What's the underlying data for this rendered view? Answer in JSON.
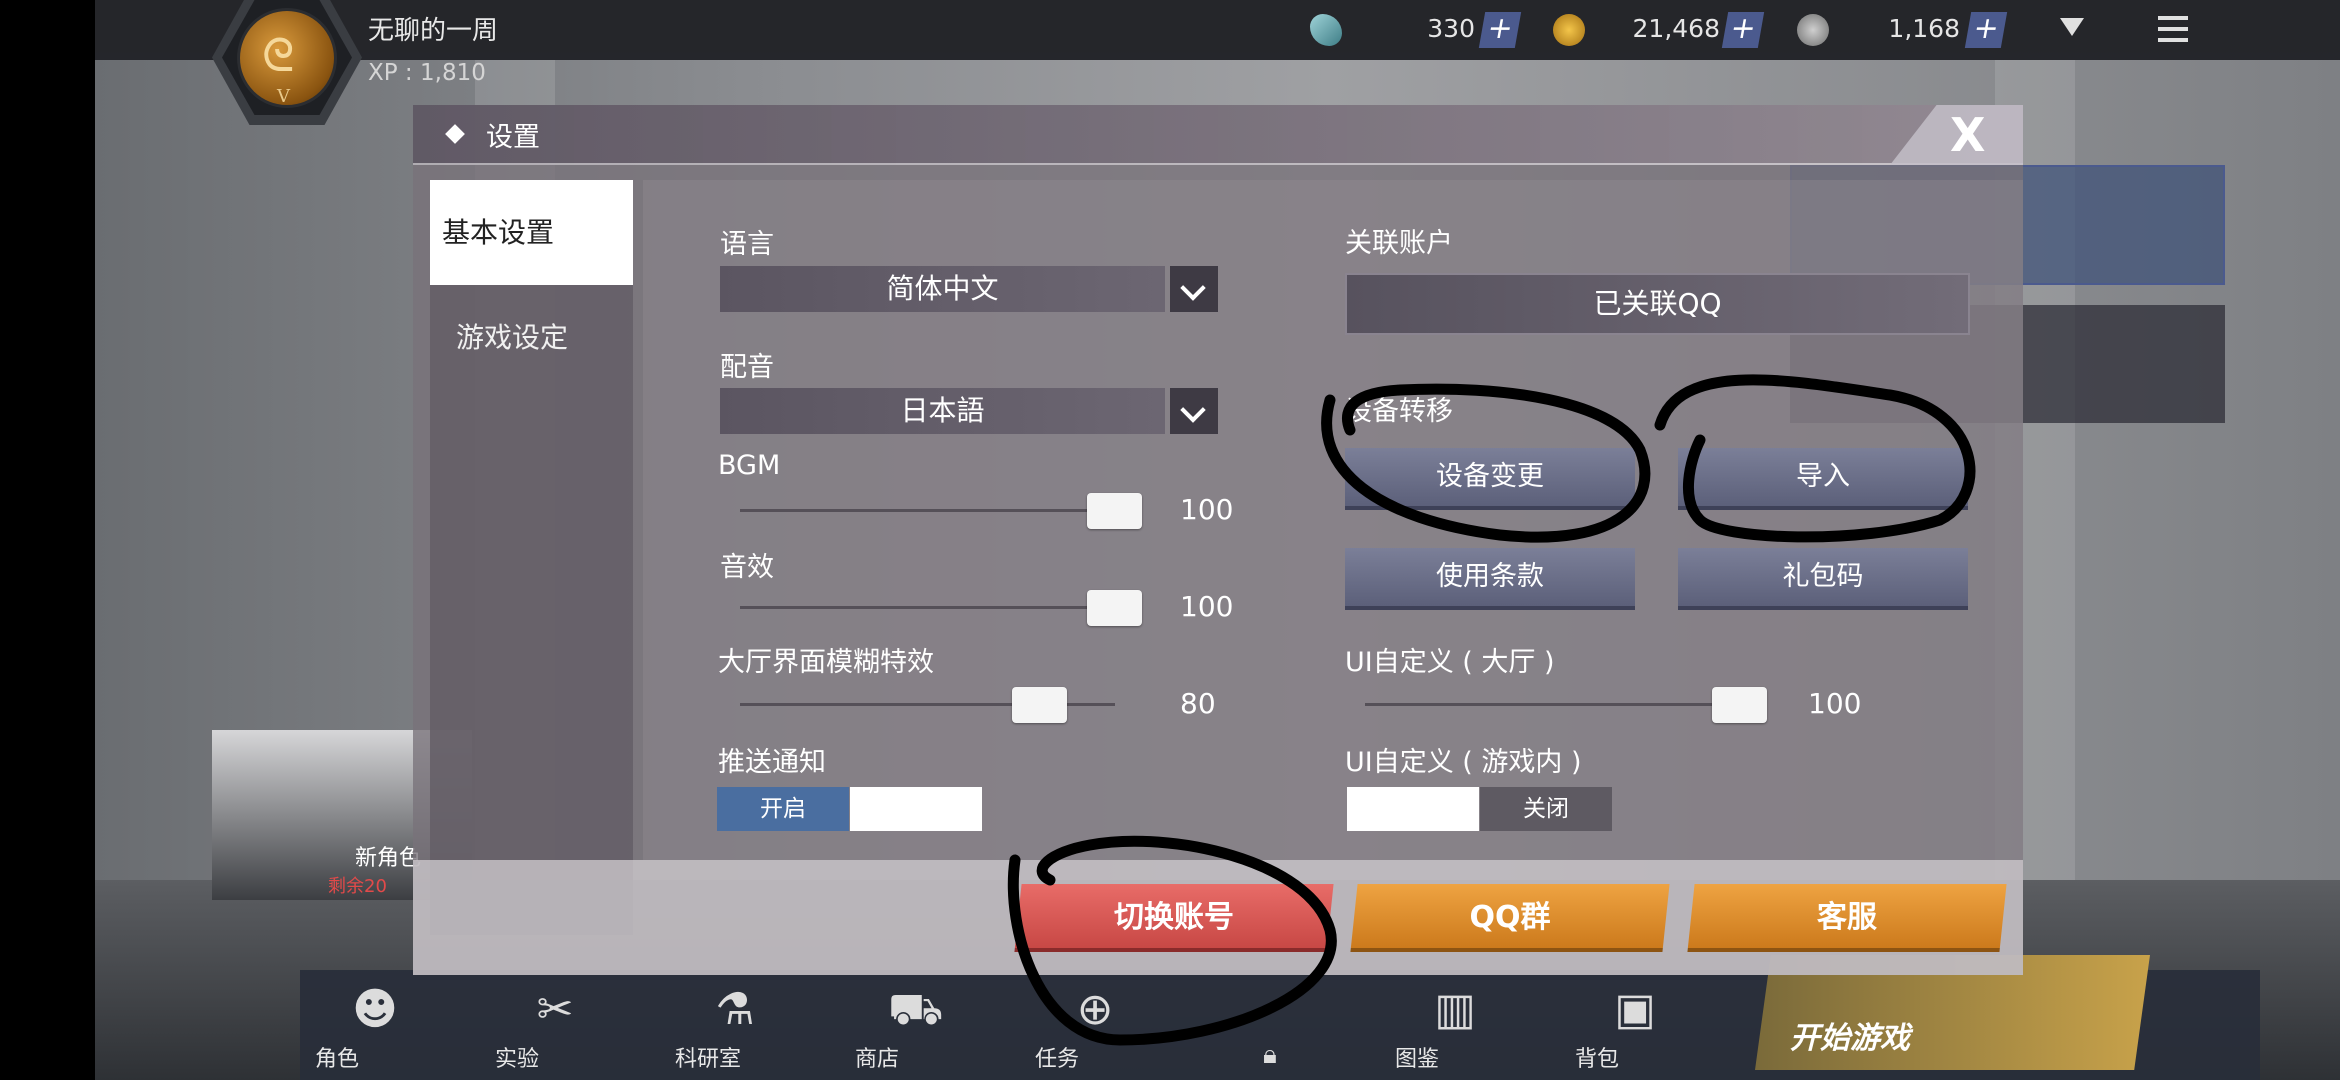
{
  "player": {
    "name": "无聊的一周",
    "xp": "XP : 1,810",
    "rank": "V"
  },
  "currencies": [
    {
      "icon": "feather-icon",
      "value": "330"
    },
    {
      "icon": "coin-icon",
      "value": "21,468"
    },
    {
      "icon": "gear-token-icon",
      "value": "1,168"
    }
  ],
  "plus_label": "+",
  "modal": {
    "title": "设置",
    "close_label": "X"
  },
  "sidebar": {
    "tabs": [
      {
        "label": "基本设置",
        "active": true
      },
      {
        "label": "游戏设定",
        "active": false
      }
    ]
  },
  "settings": {
    "language_label": "语言",
    "language_value": "简体中文",
    "voice_label": "配音",
    "voice_value": "日本語",
    "bgm_label": "BGM",
    "bgm_value": "100",
    "sfx_label": "音效",
    "sfx_value": "100",
    "blur_label": "大厅界面模糊特效",
    "blur_value": "80",
    "push_label": "推送通知",
    "push_on_label": "开启",
    "linked_account_label": "关联账户",
    "linked_account_value": "已关联QQ",
    "device_transfer_label": "设备转移",
    "device_change_button": "设备变更",
    "import_button": "导入",
    "terms_button": "使用条款",
    "gift_code_button": "礼包码",
    "ui_lobby_label": "UI自定义 ( 大厅 )",
    "ui_lobby_value": "100",
    "ui_ingame_label": "UI自定义 ( 游戏内 )",
    "ui_ingame_off_label": "关闭"
  },
  "actions": {
    "switch_account": "切换账号",
    "qq_group": "QQ群",
    "customer_service": "客服"
  },
  "nav": [
    {
      "label": "角色",
      "icon": "character-icon"
    },
    {
      "label": "实验",
      "icon": "experiment-icon"
    },
    {
      "label": "科研室",
      "icon": "flask-icon"
    },
    {
      "label": "商店",
      "icon": "cart-icon"
    },
    {
      "label": "任务",
      "icon": "target-icon"
    },
    {
      "label": "图鉴",
      "icon": "books-icon"
    },
    {
      "label": "背包",
      "icon": "backpack-icon"
    }
  ],
  "start_game": "开始游戏",
  "side_card": {
    "title": "新角色",
    "subtitle": "剩余20"
  },
  "colors": {
    "accent_blue": "#4b5a8e",
    "red_button": "#e05a56",
    "gold_button": "#e0922e",
    "toggle_on": "#4a6ea0"
  }
}
